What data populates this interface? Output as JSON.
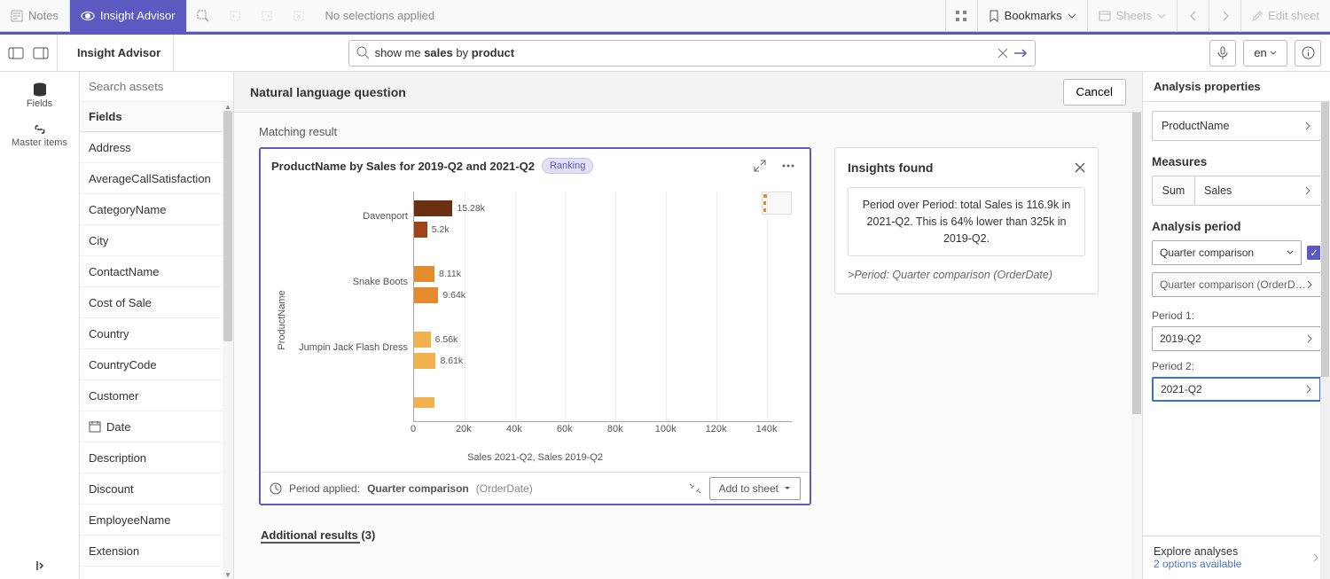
{
  "topbar": {
    "notes_label": "Notes",
    "insight_label": "Insight Advisor",
    "no_selections": "No selections applied",
    "bookmarks_label": "Bookmarks",
    "sheets_label": "Sheets",
    "edit_label": "Edit sheet"
  },
  "secondbar": {
    "page_title": "Insight Advisor",
    "search_value": "show me sales by product",
    "lang": "en"
  },
  "rail": {
    "fields_label": "Fields",
    "master_label": "Master items"
  },
  "fields_panel": {
    "search_placeholder": "Search assets",
    "header": "Fields",
    "items": [
      "Address",
      "AverageCallSatisfaction",
      "CategoryName",
      "City",
      "ContactName",
      "Cost of Sale",
      "Country",
      "CountryCode",
      "Customer",
      "Date",
      "Description",
      "Discount",
      "EmployeeName",
      "Extension"
    ]
  },
  "center": {
    "nlq_title": "Natural language question",
    "cancel_label": "Cancel",
    "matching_label": "Matching result",
    "additional_label": "Additional results (3)"
  },
  "chart_card": {
    "title": "ProductName by Sales for 2019-Q2 and 2021-Q2",
    "badge": "Ranking",
    "footer_prefix": "Period applied:",
    "footer_period": "Quarter comparison",
    "footer_field": "(OrderDate)",
    "add_sheet": "Add to sheet"
  },
  "chart_data": {
    "type": "bar",
    "orientation": "horizontal",
    "grouped": true,
    "y_categories": [
      "Davenport",
      "Snake Boots",
      "Jumpin Jack Flash Dress"
    ],
    "ylabel": "ProductName",
    "xlabel": "Sales 2021-Q2, Sales 2019-Q2",
    "xlim": [
      0,
      150000
    ],
    "x_ticks": [
      0,
      20000,
      40000,
      60000,
      80000,
      100000,
      120000,
      140000
    ],
    "x_tick_labels": [
      "0",
      "20k",
      "40k",
      "60k",
      "80k",
      "100k",
      "120k",
      "140k"
    ],
    "series": [
      {
        "name": "Sales 2021-Q2",
        "color": "#b14a1e",
        "values": [
          15280,
          8110,
          6560
        ],
        "labels": [
          "15.28k",
          "8.11k",
          "6.56k"
        ]
      },
      {
        "name": "Sales 2019-Q2",
        "color": "#e68a2e",
        "values": [
          5200,
          9640,
          8610
        ],
        "labels": [
          "5.2k",
          "9.64k",
          "8.61k"
        ]
      }
    ],
    "extra_bar": {
      "value": 8000,
      "color": "#f2b14f",
      "row": 3
    }
  },
  "insights": {
    "title": "Insights found",
    "text": "Period over Period: total Sales is 116.9k in 2021-Q2. This is 64% lower than 325k in 2019-Q2.",
    "period_prefix": ">",
    "period_text": "Period: Quarter comparison (OrderDate)"
  },
  "props": {
    "header": "Analysis properties",
    "dimension": "ProductName",
    "measures_title": "Measures",
    "agg": "Sum",
    "measure": "Sales",
    "analysis_period_title": "Analysis period",
    "period_select1_label": "Quarter comparison",
    "period_select2_label": "Quarter comparison (OrderD…",
    "period1_label": "Period 1:",
    "period1_value": "2019-Q2",
    "period2_label": "Period 2:",
    "period2_value": "2021-Q2",
    "explore_title": "Explore analyses",
    "explore_sub": "2 options available"
  }
}
